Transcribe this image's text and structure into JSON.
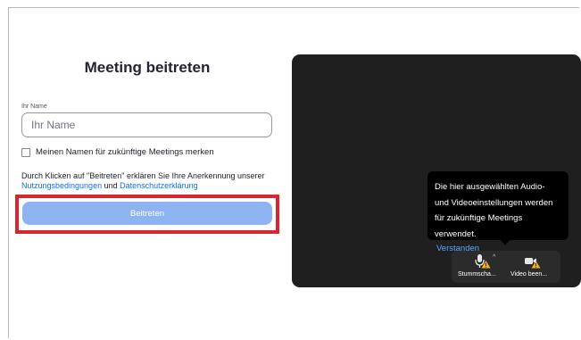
{
  "join_form": {
    "title": "Meeting beitreten",
    "name_label": "Ihr Name",
    "name_placeholder": "Ihr Name",
    "name_value": "",
    "remember_label": "Meinen Namen für zukünftige Meetings merken",
    "consent_prefix": "Durch Klicken auf \"Beitreten\" erklären Sie Ihre Anerkennung unserer ",
    "terms_link": "Nutzungsbedingungen",
    "consent_and": " und ",
    "privacy_link": "Datenschutzerklärung",
    "join_button": "Beitreten"
  },
  "preview": {
    "tooltip_text": "Die hier ausgewählten Audio- und Videoeinstellungen werden für zukünftige Meetings verwendet.",
    "tooltip_link": "Verstanden",
    "mute_label": "Stummscha...",
    "video_label": "Video been..."
  },
  "colors": {
    "accent_blue": "#0e72ed",
    "join_button_bg": "#8db3f0",
    "highlight_red": "#d9262e",
    "preview_bg": "#1f1f1f",
    "warning_yellow": "#f5b315"
  },
  "icons": [
    "microphone-icon",
    "warning-icon",
    "caret-up-icon",
    "video-camera-icon"
  ]
}
